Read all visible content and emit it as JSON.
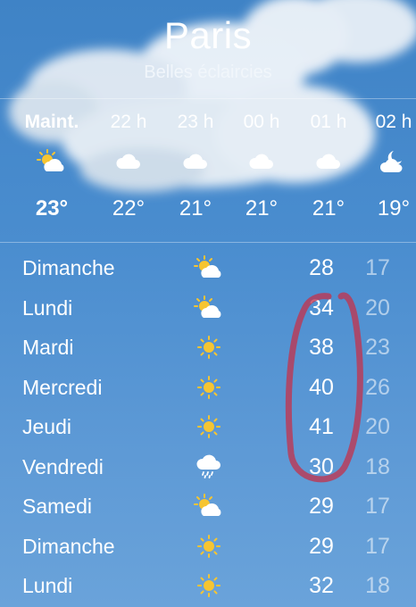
{
  "header": {
    "city": "Paris",
    "condition": "Belles éclaircies"
  },
  "hourly": [
    {
      "time": "Maint.",
      "icon": "sun-cloud-icon",
      "temp": "23°"
    },
    {
      "time": "22 h",
      "icon": "cloud-icon",
      "temp": "22°"
    },
    {
      "time": "23 h",
      "icon": "cloud-icon",
      "temp": "21°"
    },
    {
      "time": "00 h",
      "icon": "cloud-icon",
      "temp": "21°"
    },
    {
      "time": "01 h",
      "icon": "cloud-icon",
      "temp": "21°"
    },
    {
      "time": "02 h",
      "icon": "moon-cloud-icon",
      "temp": "19°"
    }
  ],
  "daily": [
    {
      "day": "Dimanche",
      "icon": "sun-cloud-icon",
      "high": "28",
      "low": "17"
    },
    {
      "day": "Lundi",
      "icon": "sun-cloud-icon",
      "high": "34",
      "low": "20"
    },
    {
      "day": "Mardi",
      "icon": "sun-icon",
      "high": "38",
      "low": "23"
    },
    {
      "day": "Mercredi",
      "icon": "sun-icon",
      "high": "40",
      "low": "26"
    },
    {
      "day": "Jeudi",
      "icon": "sun-icon",
      "high": "41",
      "low": "20"
    },
    {
      "day": "Vendredi",
      "icon": "rain-cloud-icon",
      "high": "30",
      "low": "18"
    },
    {
      "day": "Samedi",
      "icon": "sun-cloud-icon",
      "high": "29",
      "low": "17"
    },
    {
      "day": "Dimanche",
      "icon": "sun-icon",
      "high": "29",
      "low": "17"
    },
    {
      "day": "Lundi",
      "icon": "sun-icon",
      "high": "32",
      "low": "18"
    }
  ],
  "colors": {
    "sky_top": "#3f83c6",
    "sky_bottom": "#6aa3da",
    "sun": "#f6c531",
    "highlight_marker": "#c0354f"
  }
}
